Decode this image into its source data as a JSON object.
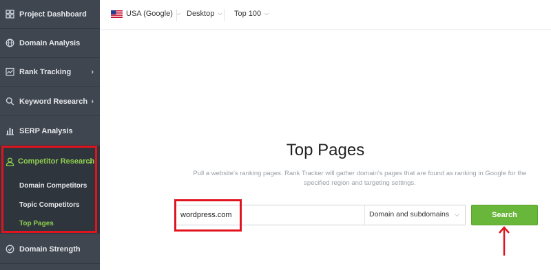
{
  "sidebar": {
    "items": [
      {
        "label": "Project Dashboard",
        "icon": "dashboard-icon"
      },
      {
        "label": "Domain Analysis",
        "icon": "globe-icon"
      },
      {
        "label": "Rank Tracking",
        "icon": "chart-line-icon",
        "has_arrow": true
      },
      {
        "label": "Keyword Research",
        "icon": "search-icon",
        "has_arrow": true
      },
      {
        "label": "SERP Analysis",
        "icon": "bar-chart-icon"
      }
    ],
    "competitor": {
      "label": "Competitor Research",
      "icon": "user-icon",
      "subitems": [
        {
          "label": "Domain Competitors"
        },
        {
          "label": "Topic Competitors"
        },
        {
          "label": "Top Pages",
          "active": true
        }
      ]
    },
    "bottom_item": {
      "label": "Domain Strength",
      "icon": "gauge-icon"
    },
    "accent_color": "#8fd14f"
  },
  "topbar": {
    "region": "USA (Google)",
    "device": "Desktop",
    "depth": "Top 100"
  },
  "main": {
    "title": "Top Pages",
    "description": "Pull a website's ranking pages. Rank Tracker will gather domain's pages that are found as ranking in Google for the specified region and targeting settings.",
    "search_value": "wordpress.com",
    "scope_select": "Domain and subdomains",
    "search_button": "Search"
  },
  "colors": {
    "sidebar_bg": "#3f4650",
    "button_green": "#69b73a",
    "annotation_red": "#e0141e"
  }
}
